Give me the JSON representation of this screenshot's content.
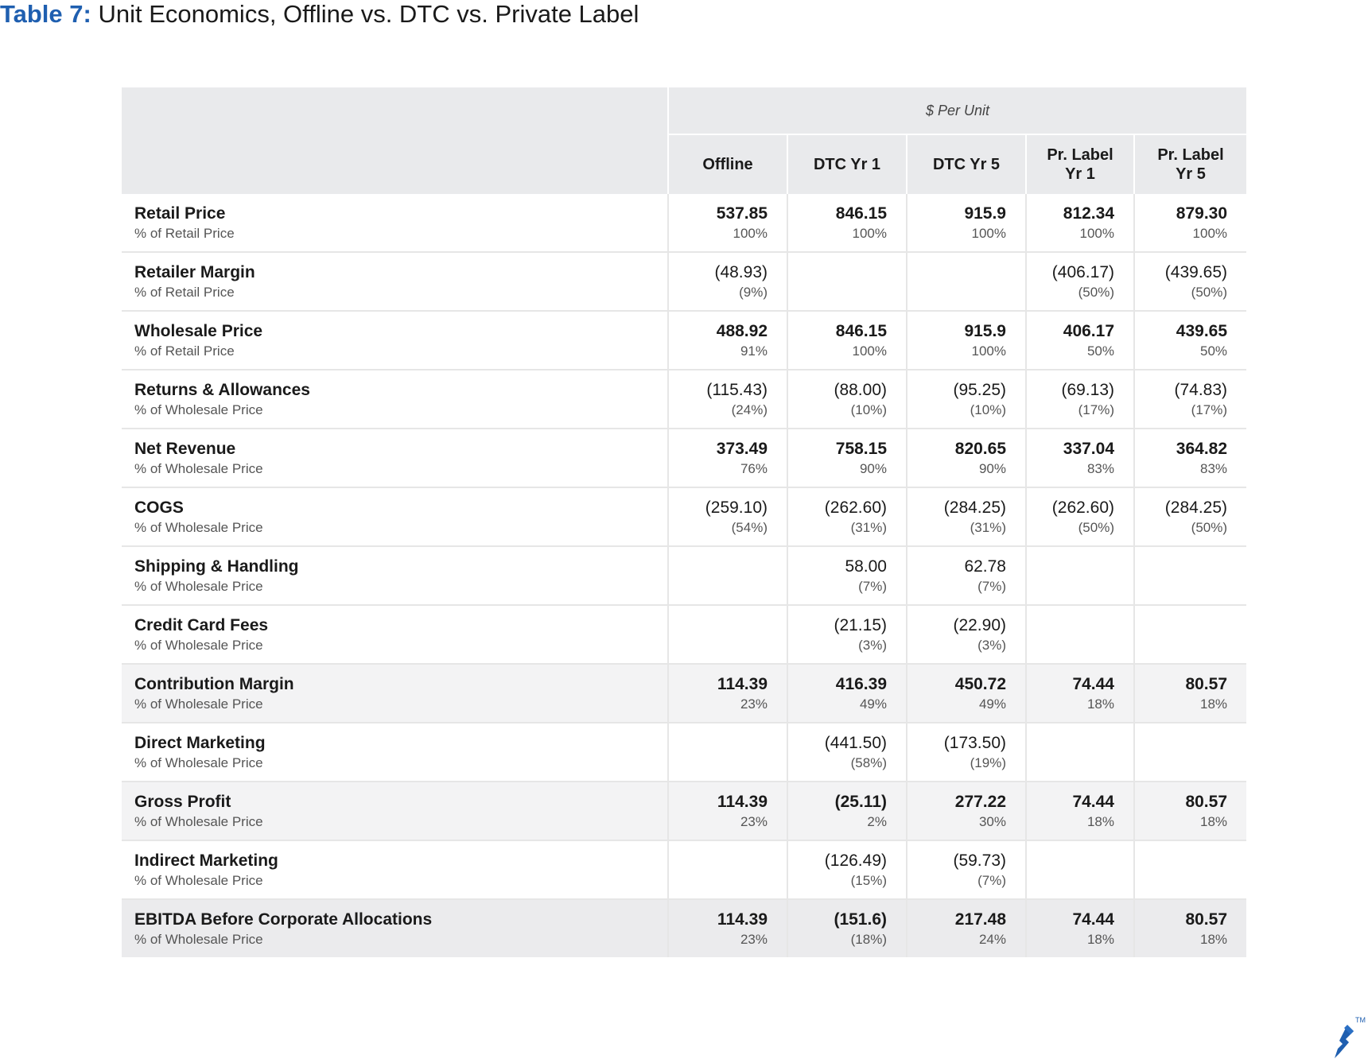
{
  "title": {
    "label": "Table 7:",
    "text": "Unit Economics, Offline vs. DTC vs. Private Label"
  },
  "table": {
    "group_header": "$ Per Unit",
    "columns": [
      {
        "line1": "Offline",
        "line2": ""
      },
      {
        "line1": "DTC Yr 1",
        "line2": ""
      },
      {
        "line1": "DTC Yr 5",
        "line2": ""
      },
      {
        "line1": "Pr. Label",
        "line2": "Yr 1"
      },
      {
        "line1": "Pr. Label",
        "line2": "Yr 5"
      }
    ],
    "rows": [
      {
        "name": "Retail Price",
        "sub": "% of Retail Price",
        "bold": true,
        "style": "",
        "cells": [
          {
            "v": "537.85",
            "p": "100%"
          },
          {
            "v": "846.15",
            "p": "100%"
          },
          {
            "v": "915.9",
            "p": "100%"
          },
          {
            "v": "812.34",
            "p": "100%"
          },
          {
            "v": "879.30",
            "p": "100%"
          }
        ]
      },
      {
        "name": "Retailer Margin",
        "sub": "% of Retail Price",
        "bold": false,
        "style": "",
        "cells": [
          {
            "v": "(48.93)",
            "p": "(9%)"
          },
          {
            "v": "",
            "p": ""
          },
          {
            "v": "",
            "p": ""
          },
          {
            "v": "(406.17)",
            "p": "(50%)"
          },
          {
            "v": "(439.65)",
            "p": "(50%)"
          }
        ]
      },
      {
        "name": "Wholesale Price",
        "sub": "% of Retail Price",
        "bold": true,
        "style": "",
        "cells": [
          {
            "v": "488.92",
            "p": "91%"
          },
          {
            "v": "846.15",
            "p": "100%"
          },
          {
            "v": "915.9",
            "p": "100%"
          },
          {
            "v": "406.17",
            "p": "50%"
          },
          {
            "v": "439.65",
            "p": "50%"
          }
        ]
      },
      {
        "name": "Returns & Allowances",
        "sub": "% of Wholesale Price",
        "bold": false,
        "style": "",
        "cells": [
          {
            "v": "(115.43)",
            "p": "(24%)"
          },
          {
            "v": "(88.00)",
            "p": "(10%)"
          },
          {
            "v": "(95.25)",
            "p": "(10%)"
          },
          {
            "v": "(69.13)",
            "p": "(17%)"
          },
          {
            "v": "(74.83)",
            "p": "(17%)"
          }
        ]
      },
      {
        "name": "Net Revenue",
        "sub": "% of Wholesale Price",
        "bold": true,
        "style": "",
        "cells": [
          {
            "v": "373.49",
            "p": "76%"
          },
          {
            "v": "758.15",
            "p": "90%"
          },
          {
            "v": "820.65",
            "p": "90%"
          },
          {
            "v": "337.04",
            "p": "83%"
          },
          {
            "v": "364.82",
            "p": "83%"
          }
        ]
      },
      {
        "name": "COGS",
        "sub": "% of Wholesale Price",
        "bold": false,
        "style": "",
        "cells": [
          {
            "v": "(259.10)",
            "p": "(54%)"
          },
          {
            "v": "(262.60)",
            "p": "(31%)"
          },
          {
            "v": "(284.25)",
            "p": "(31%)"
          },
          {
            "v": "(262.60)",
            "p": "(50%)"
          },
          {
            "v": "(284.25)",
            "p": "(50%)"
          }
        ]
      },
      {
        "name": "Shipping & Handling",
        "sub": "% of Wholesale Price",
        "bold": false,
        "style": "",
        "cells": [
          {
            "v": "",
            "p": ""
          },
          {
            "v": "58.00",
            "p": "(7%)"
          },
          {
            "v": "62.78",
            "p": "(7%)"
          },
          {
            "v": "",
            "p": ""
          },
          {
            "v": "",
            "p": ""
          }
        ]
      },
      {
        "name": "Credit Card Fees",
        "sub": "% of Wholesale Price",
        "bold": false,
        "style": "",
        "cells": [
          {
            "v": "",
            "p": ""
          },
          {
            "v": "(21.15)",
            "p": "(3%)"
          },
          {
            "v": "(22.90)",
            "p": "(3%)"
          },
          {
            "v": "",
            "p": ""
          },
          {
            "v": "",
            "p": ""
          }
        ]
      },
      {
        "name": "Contribution Margin",
        "sub": "% of Wholesale Price",
        "bold": true,
        "style": "shaded",
        "cells": [
          {
            "v": "114.39",
            "p": "23%"
          },
          {
            "v": "416.39",
            "p": "49%"
          },
          {
            "v": "450.72",
            "p": "49%"
          },
          {
            "v": "74.44",
            "p": "18%"
          },
          {
            "v": "80.57",
            "p": "18%"
          }
        ]
      },
      {
        "name": "Direct Marketing",
        "sub": "% of Wholesale Price",
        "bold": false,
        "style": "",
        "cells": [
          {
            "v": "",
            "p": ""
          },
          {
            "v": "(441.50)",
            "p": "(58%)"
          },
          {
            "v": "(173.50)",
            "p": "(19%)"
          },
          {
            "v": "",
            "p": ""
          },
          {
            "v": "",
            "p": ""
          }
        ]
      },
      {
        "name": "Gross Profit",
        "sub": "% of Wholesale Price",
        "bold": true,
        "style": "shaded",
        "cells": [
          {
            "v": "114.39",
            "p": "23%"
          },
          {
            "v": "(25.11)",
            "p": "2%"
          },
          {
            "v": "277.22",
            "p": "30%"
          },
          {
            "v": "74.44",
            "p": "18%"
          },
          {
            "v": "80.57",
            "p": "18%"
          }
        ]
      },
      {
        "name": "Indirect Marketing",
        "sub": "% of Wholesale Price",
        "bold": false,
        "style": "",
        "cells": [
          {
            "v": "",
            "p": ""
          },
          {
            "v": "(126.49)",
            "p": "(15%)"
          },
          {
            "v": "(59.73)",
            "p": "(7%)"
          },
          {
            "v": "",
            "p": ""
          },
          {
            "v": "",
            "p": ""
          }
        ]
      },
      {
        "name": "EBITDA Before Corporate Allocations",
        "sub": "% of Wholesale Price",
        "bold": true,
        "style": "dark",
        "cells": [
          {
            "v": "114.39",
            "p": "23%"
          },
          {
            "v": "(151.6)",
            "p": "(18%)"
          },
          {
            "v": "217.48",
            "p": "24%"
          },
          {
            "v": "74.44",
            "p": "18%"
          },
          {
            "v": "80.57",
            "p": "18%"
          }
        ]
      }
    ]
  },
  "colors": {
    "title_label": "#1f5fb0",
    "header_bg": "#e9eaec",
    "shaded_row_bg": "#f3f3f4",
    "logo": "#1f5fb0"
  },
  "logo": {
    "icon": "toptal-logo-icon",
    "trademark": "TM"
  }
}
